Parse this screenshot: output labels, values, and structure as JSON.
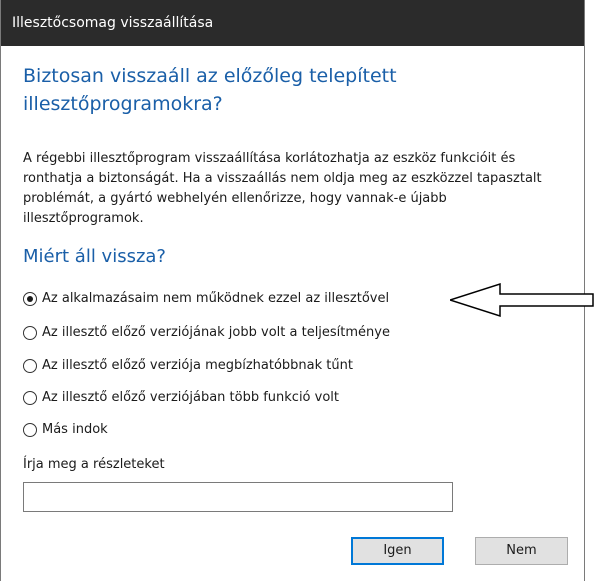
{
  "window": {
    "title": "Illesztőcsomag visszaállítása"
  },
  "dialog": {
    "question": "Biztosan visszaáll az előzőleg telepített illesztőprogramokra?",
    "description": "A régebbi illesztőprogram visszaállítása korlátozhatja az eszköz funkcióit és ronthatja a biztonságát. Ha a visszaállás nem oldja meg az eszközzel tapasztalt problémát, a gyártó webhelyén ellenőrizze, hogy vannak-e újabb illesztőprogramok.",
    "why_title": "Miért áll vissza?",
    "reasons": [
      {
        "label": "Az alkalmazásaim nem működnek ezzel az illesztővel",
        "checked": true
      },
      {
        "label": "Az illesztő előző verziójának jobb volt a teljesítménye",
        "checked": false
      },
      {
        "label": "Az illesztő előző verziója megbízhatóbbnak tűnt",
        "checked": false
      },
      {
        "label": "Az illesztő előző verziójában több funkció volt",
        "checked": false
      },
      {
        "label": "Más indok",
        "checked": false
      }
    ],
    "details_label": "Írja meg a részleteket",
    "details_value": ""
  },
  "buttons": {
    "yes_label": "Igen",
    "no_label": "Nem"
  },
  "colors": {
    "titlebar": "#2b2b2b",
    "heading": "#1a5fa8",
    "default_button_border": "#0078d7"
  },
  "icons": {
    "annotation": "left-arrow-icon"
  }
}
